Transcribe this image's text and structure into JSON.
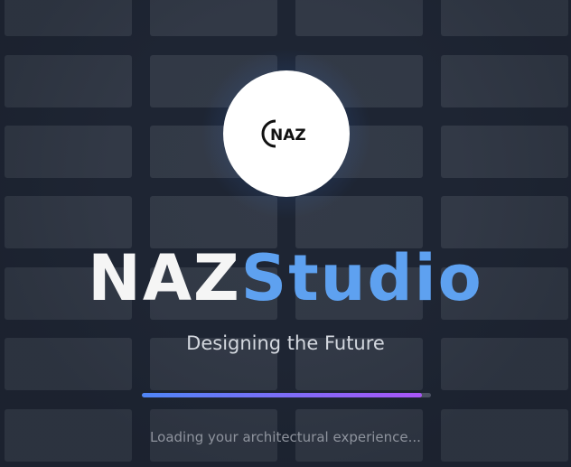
{
  "logo": {
    "text": "NAZ",
    "icon": "naz-logo-icon",
    "colors": {
      "crescent": "#e02424",
      "letters": "#111111"
    }
  },
  "brand": {
    "part1": "NAZ",
    "part2": "Studio",
    "colors": {
      "part1": "#f5f5f5",
      "part2": "#5ea1f0"
    }
  },
  "tagline": "Designing the Future",
  "progress": {
    "value": 0.97,
    "colors": {
      "start": "#4f86f7",
      "end": "#a855f7",
      "track": "#4a5060"
    }
  },
  "loading_text": "Loading your architectural experience...",
  "colors": {
    "background": "#1e2533",
    "tile": "#343b48"
  }
}
